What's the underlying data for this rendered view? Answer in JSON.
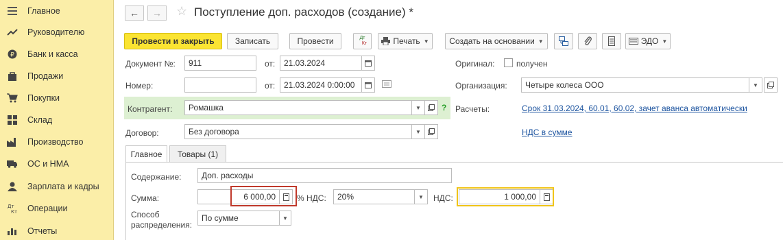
{
  "sidebar": {
    "items": [
      {
        "label": "Главное",
        "icon": "menu-icon"
      },
      {
        "label": "Руководителю",
        "icon": "trend-icon"
      },
      {
        "label": "Банк и касса",
        "icon": "coin-icon"
      },
      {
        "label": "Продажи",
        "icon": "bag-icon"
      },
      {
        "label": "Покупки",
        "icon": "cart-icon"
      },
      {
        "label": "Склад",
        "icon": "warehouse-icon"
      },
      {
        "label": "Производство",
        "icon": "factory-icon"
      },
      {
        "label": "ОС и НМА",
        "icon": "truck-icon"
      },
      {
        "label": "Зарплата и кадры",
        "icon": "person-icon"
      },
      {
        "label": "Операции",
        "icon": "dt-kt-icon"
      },
      {
        "label": "Отчеты",
        "icon": "bar-chart-icon"
      }
    ]
  },
  "header": {
    "title": "Поступление доп. расходов (создание) *"
  },
  "toolbar": {
    "post_close": "Провести и закрыть",
    "save": "Записать",
    "post": "Провести",
    "dtkt_top": "Дт",
    "dtkt_bottom": "Кт",
    "print": "Печать",
    "create_based": "Создать на основании",
    "edo": "ЭДО"
  },
  "form": {
    "doc_no_label": "Документ №:",
    "doc_no_value": "911",
    "from_label": "от:",
    "doc_date": "21.03.2024",
    "original_label": "Оригинал:",
    "received_label": "получен",
    "number_label": "Номер:",
    "number_value": "",
    "from2_label": "от:",
    "number_date": "21.03.2024  0:00:00",
    "org_label": "Организация:",
    "org_value": "Четыре колеса ООО",
    "contractor_label": "Контрагент:",
    "contractor_value": "Ромашка",
    "help": "?",
    "settlements_label": "Расчеты:",
    "settlements_link": "Срок 31.03.2024, 60.01, 60.02, зачет аванса автоматически",
    "contract_label": "Договор:",
    "contract_value": "Без договора",
    "vat_link": "НДС в сумме"
  },
  "tabs": [
    {
      "label": "Главное"
    },
    {
      "label": "Товары (1)"
    }
  ],
  "main_tab": {
    "content_label": "Содержание:",
    "content_value": "Доп. расходы",
    "sum_label": "Сумма:",
    "sum_value": "6 000,00",
    "vat_rate_label": "% НДС:",
    "vat_rate_value": "20%",
    "vat_label": "НДС:",
    "vat_value": "1 000,00",
    "distribution_label_1": "Способ",
    "distribution_label_2": "распределения:",
    "distribution_value": "По сумме"
  },
  "colors": {
    "sidebar_bg": "#fbeea8",
    "primary_btn": "#fbe432",
    "highlight_red": "#c0392b",
    "highlight_yellow": "#f0c419",
    "link": "#1e55a0",
    "contractor_band": "#ddf0d2"
  }
}
